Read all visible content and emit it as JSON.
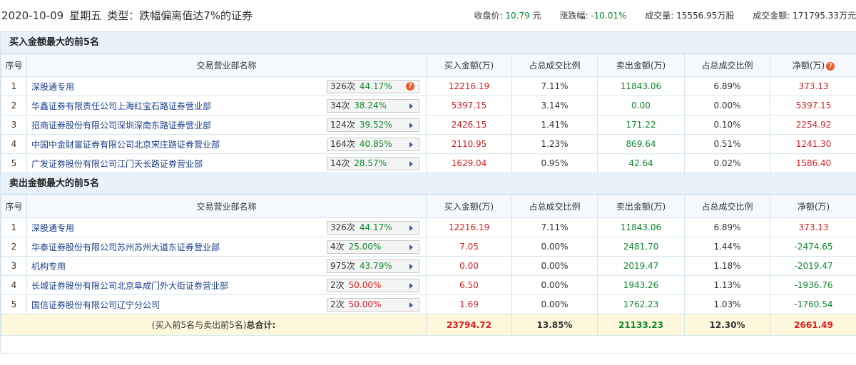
{
  "header": {
    "date": "2020-10-09",
    "weekday": "星期五",
    "type": "类型：跌幅偏离值达7%的证券",
    "close_label": "收盘价:",
    "close_value": "10.79",
    "close_unit": "元",
    "change_label": "涨跌幅:",
    "change_value": "-10.01%",
    "volume_label": "成交量:",
    "volume_value": "15556.95万股",
    "amount_label": "成交金额:",
    "amount_value": "171795.33万元"
  },
  "columns": {
    "idx": "序号",
    "name": "交易营业部名称",
    "buy": "买入金额(万)",
    "buy_ratio": "占总成交比例",
    "sell": "卖出金额(万)",
    "sell_ratio": "占总成交比例",
    "net_top": "净额(万)",
    "net_bottom": "净额(万)"
  },
  "buy_section": {
    "title": "买入金额最大的前5名",
    "rows": [
      {
        "idx": "1",
        "name": "深股通专用",
        "count": "326次",
        "pct": "44.17%",
        "buy": "12216.19",
        "buy_ratio": "7.11%",
        "sell": "11843.06",
        "sell_ratio": "6.89%",
        "net": "373.13"
      },
      {
        "idx": "2",
        "name": "华鑫证券有限责任公司上海红宝石路证券营业部",
        "count": "34次",
        "pct": "38.24%",
        "buy": "5397.15",
        "buy_ratio": "3.14%",
        "sell": "0.00",
        "sell_ratio": "0.00%",
        "net": "5397.15"
      },
      {
        "idx": "3",
        "name": "招商证券股份有限公司深圳深南东路证券营业部",
        "count": "124次",
        "pct": "39.52%",
        "buy": "2426.15",
        "buy_ratio": "1.41%",
        "sell": "171.22",
        "sell_ratio": "0.10%",
        "net": "2254.92"
      },
      {
        "idx": "4",
        "name": "中国中金财富证券有限公司北京宋庄路证券营业部",
        "count": "164次",
        "pct": "40.85%",
        "buy": "2110.95",
        "buy_ratio": "1.23%",
        "sell": "869.64",
        "sell_ratio": "0.51%",
        "net": "1241.30"
      },
      {
        "idx": "5",
        "name": "广发证券股份有限公司江门天长路证券营业部",
        "count": "14次",
        "pct": "28.57%",
        "buy": "1629.04",
        "buy_ratio": "0.95%",
        "sell": "42.64",
        "sell_ratio": "0.02%",
        "net": "1586.40"
      }
    ]
  },
  "sell_section": {
    "title": "卖出金额最大的前5名",
    "rows": [
      {
        "idx": "1",
        "name": "深股通专用",
        "count": "326次",
        "pct": "44.17%",
        "buy": "12216.19",
        "buy_ratio": "7.11%",
        "sell": "11843.06",
        "sell_ratio": "6.89%",
        "net": "373.13"
      },
      {
        "idx": "2",
        "name": "华泰证券股份有限公司苏州苏州大道东证券营业部",
        "count": "4次",
        "pct": "25.00%",
        "buy": "7.05",
        "buy_ratio": "0.00%",
        "sell": "2481.70",
        "sell_ratio": "1.44%",
        "net": "-2474.65"
      },
      {
        "idx": "3",
        "name": "机构专用",
        "count": "975次",
        "pct": "43.79%",
        "buy": "0.00",
        "buy_ratio": "0.00%",
        "sell": "2019.47",
        "sell_ratio": "1.18%",
        "net": "-2019.47"
      },
      {
        "idx": "4",
        "name": "长城证券股份有限公司北京阜成门外大街证券营业部",
        "count": "2次",
        "pct": "50.00%",
        "buy": "6.50",
        "buy_ratio": "0.00%",
        "sell": "1943.26",
        "sell_ratio": "1.13%",
        "net": "-1936.76"
      },
      {
        "idx": "5",
        "name": "国信证券股份有限公司辽宁分公司",
        "count": "2次",
        "pct": "50.00%",
        "buy": "1.69",
        "buy_ratio": "0.00%",
        "sell": "1762.23",
        "sell_ratio": "1.03%",
        "net": "-1760.54"
      }
    ]
  },
  "total": {
    "label_prefix": "(买入前5名与卖出前5名)",
    "label_bold": "总合计:",
    "buy": "23794.72",
    "buy_ratio": "13.85%",
    "sell": "21133.23",
    "sell_ratio": "12.30%",
    "net": "2661.49"
  }
}
